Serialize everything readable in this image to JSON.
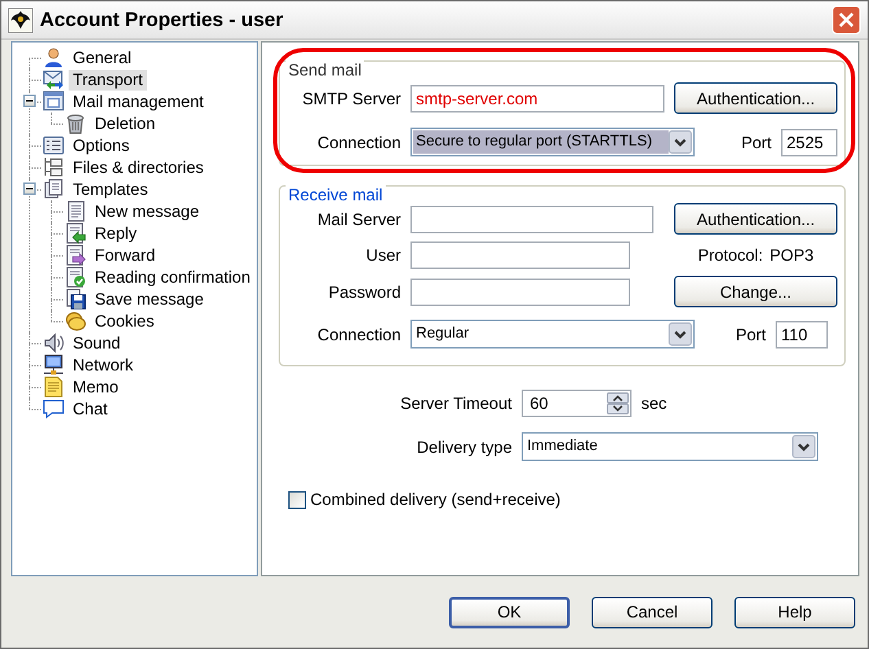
{
  "window": {
    "title": "Account Properties - user"
  },
  "tree": [
    {
      "label": "General",
      "selected": false
    },
    {
      "label": "Transport",
      "selected": true
    },
    {
      "label": "Mail management",
      "selected": false,
      "expanded": true,
      "children": [
        {
          "label": "Deletion",
          "selected": false
        }
      ]
    },
    {
      "label": "Options",
      "selected": false
    },
    {
      "label": "Files & directories",
      "selected": false
    },
    {
      "label": "Templates",
      "selected": false,
      "expanded": true,
      "children": [
        {
          "label": "New message",
          "selected": false
        },
        {
          "label": "Reply",
          "selected": false
        },
        {
          "label": "Forward",
          "selected": false
        },
        {
          "label": "Reading confirmation",
          "selected": false
        },
        {
          "label": "Save message",
          "selected": false
        },
        {
          "label": "Cookies",
          "selected": false
        }
      ]
    },
    {
      "label": "Sound",
      "selected": false
    },
    {
      "label": "Network",
      "selected": false
    },
    {
      "label": "Memo",
      "selected": false
    },
    {
      "label": "Chat",
      "selected": false
    }
  ],
  "send_mail": {
    "title": "Send mail",
    "highlighted": true,
    "smtp_server": {
      "label": "SMTP Server",
      "value": "smtp-server.com"
    },
    "authentication_button": "Authentication...",
    "connection": {
      "label": "Connection",
      "value": "Secure to regular port (STARTTLS)",
      "focused": true
    },
    "port": {
      "label": "Port",
      "value": "2525"
    }
  },
  "receive_mail": {
    "title": "Receive mail",
    "mail_server": {
      "label": "Mail Server"
    },
    "authentication_button": "Authentication...",
    "user": {
      "label": "User"
    },
    "protocol": {
      "label": "Protocol:",
      "value": "POP3"
    },
    "password": {
      "label": "Password"
    },
    "change_button": "Change...",
    "connection": {
      "label": "Connection",
      "value": "Regular",
      "focused": false
    },
    "port": {
      "label": "Port",
      "value": "110"
    }
  },
  "server_timeout": {
    "label": "Server Timeout",
    "value": "60",
    "unit": "sec"
  },
  "delivery_type": {
    "label": "Delivery type",
    "value": "Immediate"
  },
  "combined_delivery": {
    "label": "Combined delivery (send+receive)",
    "checked": false
  },
  "buttons": [
    {
      "label": "OK",
      "default": true
    },
    {
      "label": "Cancel",
      "default": false
    },
    {
      "label": "Help",
      "default": false
    }
  ]
}
